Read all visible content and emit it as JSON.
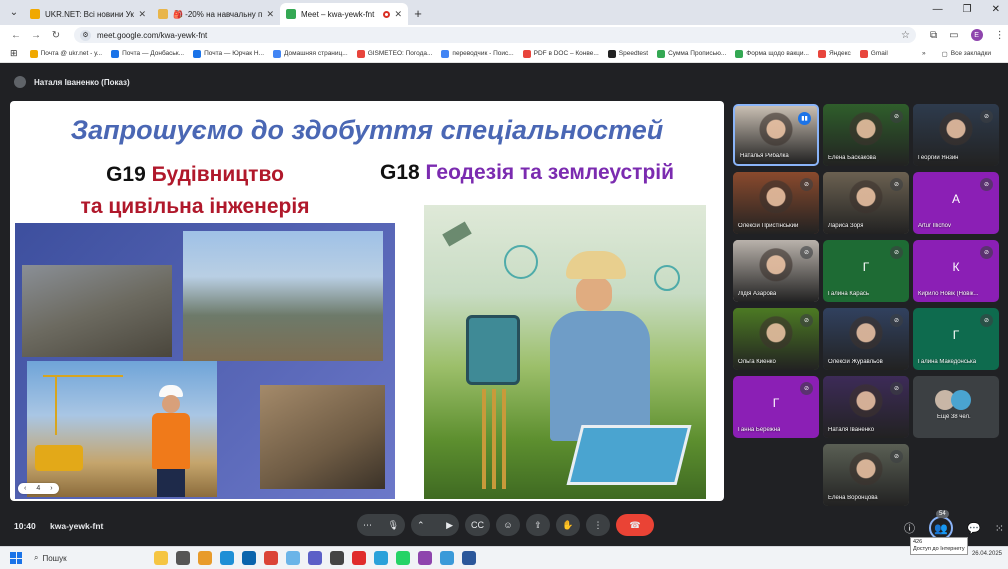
{
  "browser": {
    "tabs": [
      {
        "title": "UKR.NET: Всі новини України,",
        "fav": "#f0a800",
        "active": false
      },
      {
        "title": "🎒 -20% на навчальну програ",
        "fav": "#e8b54a",
        "active": false
      },
      {
        "title": "Meet – kwa-yewk-fnt",
        "fav": "#34a853",
        "active": true
      }
    ],
    "new_tab": "+",
    "url": "meet.google.com/kwa-yewk-fnt",
    "profile_letter": "Е",
    "bookmarks": [
      {
        "label": "Почта @ ukr.net - у...",
        "color": "#f0a800"
      },
      {
        "label": "Почта — Донбаськ...",
        "color": "#1a73e8"
      },
      {
        "label": "Почта — Юрчак Н...",
        "color": "#1a73e8"
      },
      {
        "label": "Домашняя страниц...",
        "color": "#4285f4"
      },
      {
        "label": "GISMETEO: Погода...",
        "color": "#e8453c"
      },
      {
        "label": "переводчик - Поис...",
        "color": "#4285f4"
      },
      {
        "label": "PDF в DOC – Конве...",
        "color": "#e8453c"
      },
      {
        "label": "Speedtest",
        "color": "#222"
      },
      {
        "label": "Сумма Прописью...",
        "color": "#34a853"
      },
      {
        "label": "Форма щодо вакци...",
        "color": "#34a853"
      },
      {
        "label": "Яндекс",
        "color": "#e8453c"
      },
      {
        "label": "Gmail",
        "color": "#e8453c"
      }
    ],
    "all_bookmarks": "Все закладки"
  },
  "meet": {
    "presenter": "Наталя Іваненко (Показ)",
    "clock": "10:40",
    "meeting_code": "kwa-yewk-fnt",
    "people_count": "54",
    "tooltip_line1": "426",
    "tooltip_line2": "Доступ до Інтернету",
    "slide": {
      "title": "Запрошуємо до здобуття спеціальностей",
      "g19_code": "G19",
      "g19_line1": "Будівництво",
      "g19_line2": "та цивільна інженерія",
      "g18_code": "G18",
      "g18_title": "Геодезія та землеустрій",
      "page": "4",
      "prev": "‹",
      "next": "›"
    },
    "participants": [
      {
        "name": "Наталья Рибалка",
        "type": "video",
        "mic": "speak",
        "bg": "#c9bfb3"
      },
      {
        "name": "Елена Баскакова",
        "type": "video",
        "mic": "off",
        "bg": "#2f5e2b"
      },
      {
        "name": "Георгий Янзин",
        "type": "video",
        "mic": "off",
        "bg": "#2e3b4d"
      },
      {
        "name": "Олексій Пристінський",
        "type": "video",
        "mic": "off",
        "bg": "#8a4a2d"
      },
      {
        "name": "Лариса Зоря",
        "type": "video",
        "mic": "off",
        "bg": "#6b6151"
      },
      {
        "name": "Artur Illichov",
        "type": "avatar",
        "letter": "A",
        "mic": "off",
        "bg": "#8b1fb5"
      },
      {
        "name": "Лідія Азарова",
        "type": "video",
        "mic": "off",
        "bg": "#b9b2ab"
      },
      {
        "name": "Галина Карась",
        "type": "avatar",
        "letter": "Г",
        "mic": "off",
        "bg": "#1e6b34"
      },
      {
        "name": "Кирило Новік (Новік...",
        "type": "avatar",
        "letter": "К",
        "mic": "off",
        "bg": "#8b1fb5"
      },
      {
        "name": "Ольга Киенко",
        "type": "video",
        "mic": "off",
        "bg": "#4c7a23"
      },
      {
        "name": "Олексій Журавльов",
        "type": "video",
        "mic": "off",
        "bg": "#31415f"
      },
      {
        "name": "Галина Македонська",
        "type": "avatar",
        "letter": "Г",
        "mic": "off",
        "bg": "#0e6b4e"
      },
      {
        "name": "Ганна Бережна",
        "type": "avatar",
        "letter": "Г",
        "mic": "off",
        "bg": "#8b1fb5"
      },
      {
        "name": "Наталя Іваненко",
        "type": "video",
        "mic": "off",
        "bg": "#3d2b58"
      },
      {
        "name": "Ещё 38 чел.",
        "type": "more",
        "mic": "none",
        "bg": "#3c4043"
      },
      {
        "name": "Елена Воронцова",
        "type": "video",
        "mic": "off",
        "bg": "#5a5f54"
      }
    ]
  },
  "taskbar": {
    "search": "Пошук",
    "date": "26.04.2025",
    "lang": "УКР"
  }
}
